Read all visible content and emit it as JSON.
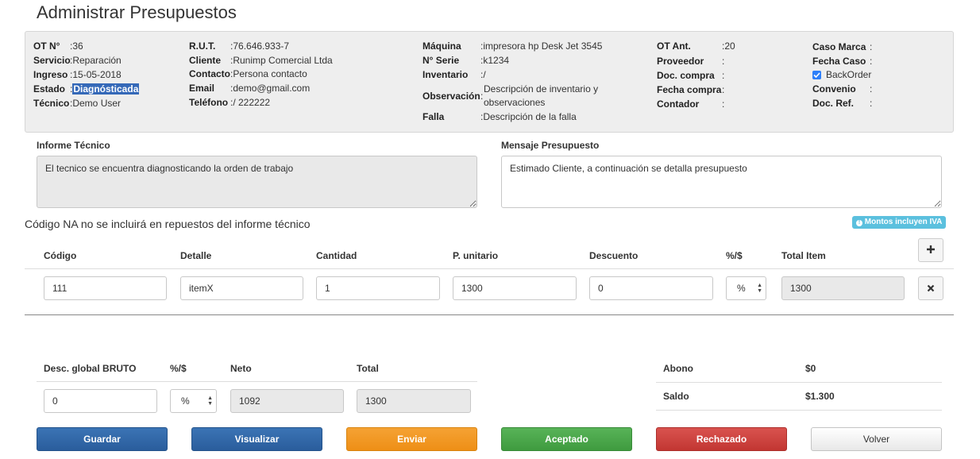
{
  "page": {
    "title": "Administrar Presupuestos"
  },
  "info": {
    "col1": [
      {
        "label": "OT N°",
        "value": "36"
      },
      {
        "label": "Servicio",
        "value": "Reparación"
      },
      {
        "label": "Ingreso",
        "value": "15-05-2018"
      },
      {
        "label": "Estado",
        "value": "Diagnósticada"
      },
      {
        "label": "Técnico",
        "value": "Demo User"
      }
    ],
    "col2": [
      {
        "label": "R.U.T.",
        "value": "76.646.933-7"
      },
      {
        "label": "Cliente",
        "value": "Runimp Comercial Ltda"
      },
      {
        "label": "Contacto",
        "value": "Persona contacto"
      },
      {
        "label": "Email",
        "value": "demo@gmail.com"
      },
      {
        "label": "Teléfono",
        "value": "/ 222222"
      }
    ],
    "col3": [
      {
        "label": "Máquina",
        "value": "impresora hp Desk Jet 3545"
      },
      {
        "label": "N° Serie",
        "value": "k1234"
      },
      {
        "label": "Inventario",
        "value": "/"
      },
      {
        "label": "Observación",
        "value_line1": "Descripción de inventario y",
        "value_line2": "observaciones"
      },
      {
        "label": "Falla",
        "value": "Descripción de la falla"
      }
    ],
    "col4": [
      {
        "label": "OT Ant.",
        "value": "20"
      },
      {
        "label": "Proveedor",
        "value": ""
      },
      {
        "label": "Doc. compra",
        "value": ""
      },
      {
        "label": "Fecha compra",
        "value": ""
      },
      {
        "label": "Contador",
        "value": ""
      }
    ],
    "col5": [
      {
        "label": "Caso Marca",
        "value": ""
      },
      {
        "label": "Fecha Caso",
        "value": ""
      },
      {
        "label": "BackOrder",
        "checked": true
      },
      {
        "label": "Convenio",
        "value": ""
      },
      {
        "label": "Doc. Ref.",
        "value": ""
      }
    ]
  },
  "informe": {
    "label": "Informe Técnico",
    "text": "El tecnico se encuentra diagnosticando la orden de trabajo"
  },
  "mensaje": {
    "label": "Mensaje Presupuesto",
    "text": "Estimado Cliente, a continuación se detalla presupuesto"
  },
  "note": "Código NA no se incluirá en repuestos del informe técnico",
  "iva_badge": "Montos incluyen IVA",
  "items_table": {
    "headers": [
      "Código",
      "Detalle",
      "Cantidad",
      "P. unitario",
      "Descuento",
      "%/$",
      "Total Item"
    ],
    "rows": [
      {
        "codigo": "111",
        "detalle": "itemX",
        "cantidad": "1",
        "p_unitario": "1300",
        "descuento": "0",
        "tipo": "%",
        "total": "1300"
      }
    ]
  },
  "totals": {
    "headers": [
      "Desc. global BRUTO",
      "%/$",
      "Neto",
      "Total"
    ],
    "desc_global": "0",
    "tipo": "%",
    "neto": "1092",
    "total": "1300"
  },
  "summary": {
    "abono_label": "Abono",
    "abono_value": "$0",
    "saldo_label": "Saldo",
    "saldo_value": "$1.300"
  },
  "buttons": {
    "guardar": "Guardar",
    "visualizar": "Visualizar",
    "enviar": "Enviar",
    "aceptado": "Aceptado",
    "rechazado": "Rechazado",
    "volver": "Volver"
  },
  "colors": {
    "primary": "#2a5d9c",
    "warning": "#ee8f16",
    "success": "#3f9b3f",
    "danger": "#c23632",
    "info": "#5bc0de",
    "selection": "#3569b8"
  },
  "icons": {
    "add": "plus-icon",
    "remove": "close-icon",
    "info": "info-circle-icon",
    "select": "updown-arrows-icon"
  }
}
